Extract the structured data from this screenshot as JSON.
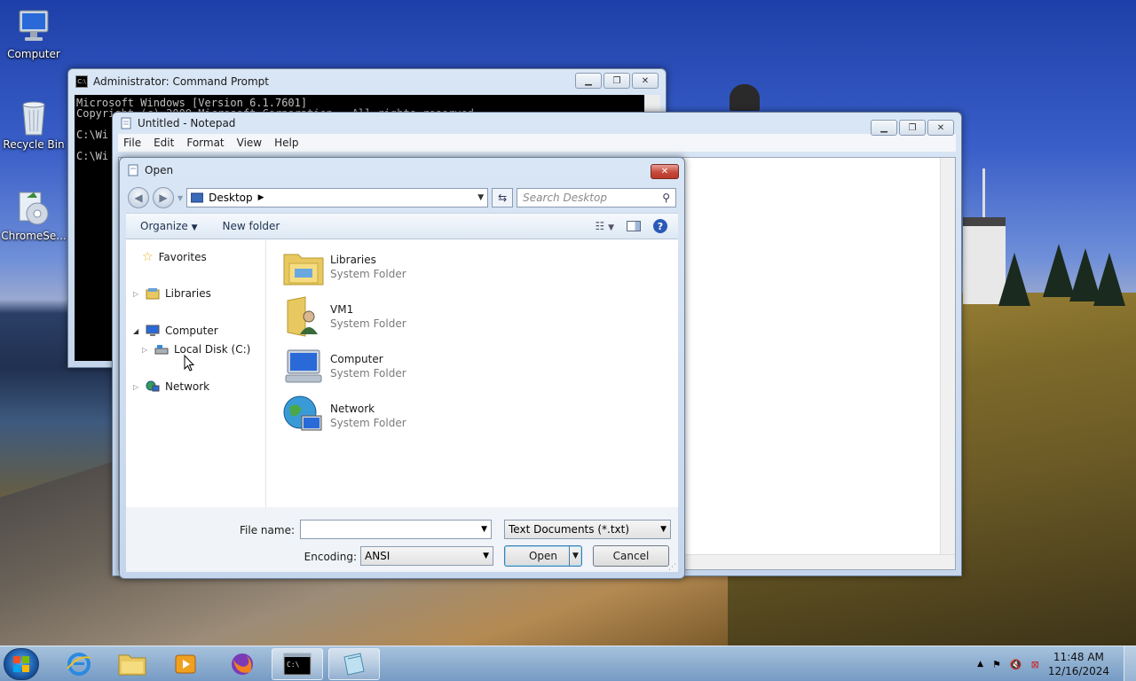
{
  "desktop": {
    "icons": [
      {
        "label": "Computer",
        "icon": "computer-icon"
      },
      {
        "label": "Recycle Bin",
        "icon": "recycle-bin-icon"
      },
      {
        "label": "ChromeSe...",
        "icon": "chrome-setup-icon"
      }
    ]
  },
  "cmd_window": {
    "title": "Administrator: Command Prompt",
    "lines": [
      "Microsoft Windows [Version 6.1.7601]",
      "Copyright (c) 2009 Microsoft Corporation.  All rights reserved.",
      "",
      "C:\\Wi",
      "",
      "C:\\Wi"
    ]
  },
  "notepad_window": {
    "title": "Untitled - Notepad",
    "menu": [
      "File",
      "Edit",
      "Format",
      "View",
      "Help"
    ]
  },
  "open_dialog": {
    "title": "Open",
    "address": "Desktop",
    "search_placeholder": "Search Desktop",
    "toolbar": {
      "organize": "Organize",
      "new_folder": "New folder"
    },
    "nav_pane": {
      "favorites": "Favorites",
      "libraries": "Libraries",
      "computer": "Computer",
      "local_disk": "Local Disk (C:)",
      "network": "Network"
    },
    "files": [
      {
        "name": "Libraries",
        "type": "System Folder"
      },
      {
        "name": "VM1",
        "type": "System Folder"
      },
      {
        "name": "Computer",
        "type": "System Folder"
      },
      {
        "name": "Network",
        "type": "System Folder"
      }
    ],
    "file_name_label": "File name:",
    "file_name_value": "",
    "file_type_value": "Text Documents (*.txt)",
    "encoding_label": "Encoding:",
    "encoding_value": "ANSI",
    "open_label": "Open",
    "cancel_label": "Cancel"
  },
  "taskbar": {
    "time": "11:48 AM",
    "date": "12/16/2024"
  }
}
